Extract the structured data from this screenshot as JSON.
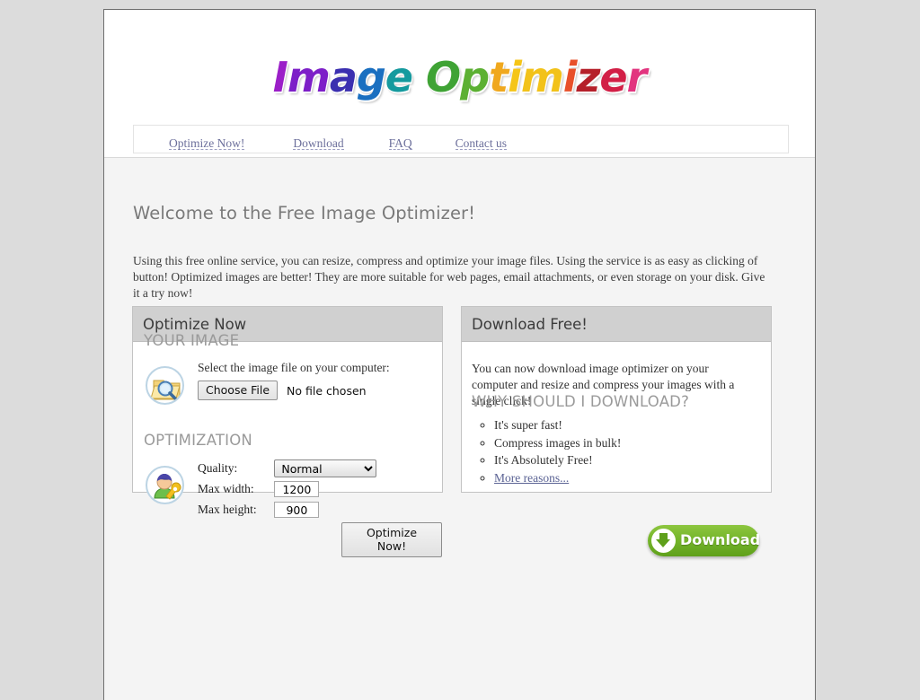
{
  "logo": {
    "letters": [
      {
        "ch": "I",
        "color": "#9b1fc8"
      },
      {
        "ch": "m",
        "color": "#7d1fc8"
      },
      {
        "ch": "a",
        "color": "#3b2fb0"
      },
      {
        "ch": "g",
        "color": "#1a6fc0"
      },
      {
        "ch": "e",
        "color": "#159a9e"
      },
      {
        "ch": " ",
        "color": "#000000"
      },
      {
        "ch": "O",
        "color": "#3fa335"
      },
      {
        "ch": "p",
        "color": "#5cb033"
      },
      {
        "ch": "t",
        "color": "#f0a81e"
      },
      {
        "ch": "i",
        "color": "#f5c518"
      },
      {
        "ch": "m",
        "color": "#f2c21a"
      },
      {
        "ch": "i",
        "color": "#e8502a"
      },
      {
        "ch": "z",
        "color": "#b5202a"
      },
      {
        "ch": "e",
        "color": "#d21f46"
      },
      {
        "ch": "r",
        "color": "#e2357f"
      }
    ],
    "alt": "Image Optimizer"
  },
  "nav": {
    "items": [
      {
        "label": "Optimize Now!"
      },
      {
        "label": "Download"
      },
      {
        "label": "FAQ"
      },
      {
        "label": "Contact us"
      }
    ]
  },
  "main": {
    "heading": "Welcome to the Free Image Optimizer!",
    "intro": "Using this free online service, you can resize, compress and optimize your image files. Using the service is as easy as clicking of button! Optimized images are better! They are more suitable for web pages, email attachments, or even storage on your disk. Give it a try now!"
  },
  "optimize_panel": {
    "title": "Optimize Now",
    "your_image_label": "YOUR IMAGE",
    "select_file_text": "Select the image file on your computer:",
    "choose_file_button": "Choose File",
    "file_status": "No file chosen",
    "optimization_label": "OPTIMIZATION",
    "quality_label": "Quality:",
    "quality_value": "Normal",
    "quality_options": [
      "Normal"
    ],
    "max_width_label": "Max width:",
    "max_width_value": "1200",
    "max_height_label": "Max height:",
    "max_height_value": "900",
    "submit_button": "Optimize Now!"
  },
  "download_panel": {
    "title": "Download Free!",
    "description": "You can now download image optimizer on your computer and resize and compress your images with a single click!",
    "why_label": "WHY SHOULD I DOWNLOAD?",
    "reasons": [
      "It's super fast!",
      "Compress images in bulk!",
      "It's Absolutely Free!"
    ],
    "more_reasons_link": "More reasons...",
    "download_button": "Download"
  },
  "colors": {
    "page_background": "#dcdcdc",
    "content_background": "#f4f4f4",
    "panel_header": "#d0d0d0",
    "nav_link": "#6c6f9b",
    "heading_gray": "#7a7a7a",
    "download_green": "#76b62c"
  }
}
